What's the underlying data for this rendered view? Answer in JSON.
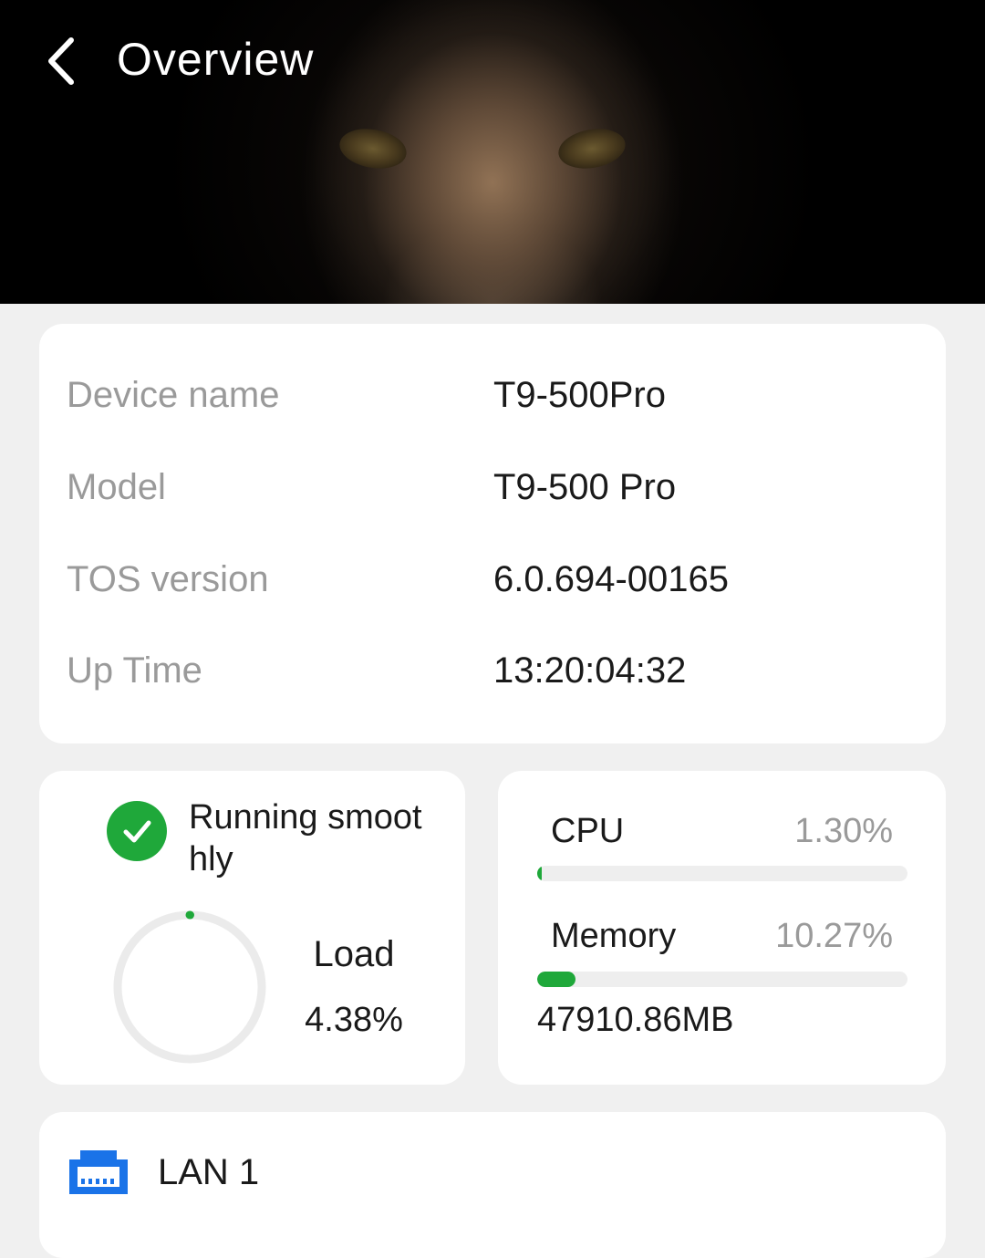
{
  "header": {
    "title": "Overview",
    "back_icon": "chevron-left-icon"
  },
  "device_info": {
    "rows": [
      {
        "label": "Device name",
        "value": "T9-500Pro"
      },
      {
        "label": "Model",
        "value": "T9-500 Pro"
      },
      {
        "label": "TOS version",
        "value": "6.0.694-00165"
      },
      {
        "label": "Up Time",
        "value": "13:20:04:32"
      }
    ]
  },
  "status": {
    "text": "Running smoothly",
    "icon": "check-circle-icon",
    "load_label": "Load",
    "load_value": "4.38%",
    "load_fraction": 0.0438
  },
  "resources": {
    "cpu_label": "CPU",
    "cpu_value": "1.30%",
    "cpu_fraction": 0.013,
    "memory_label": "Memory",
    "memory_value": "10.27%",
    "memory_fraction": 0.1027,
    "memory_size": "47910.86MB"
  },
  "lan": {
    "label": "LAN 1",
    "icon": "ethernet-port-icon"
  },
  "colors": {
    "accent": "#1fa83a",
    "icon_blue": "#1a73e8"
  }
}
